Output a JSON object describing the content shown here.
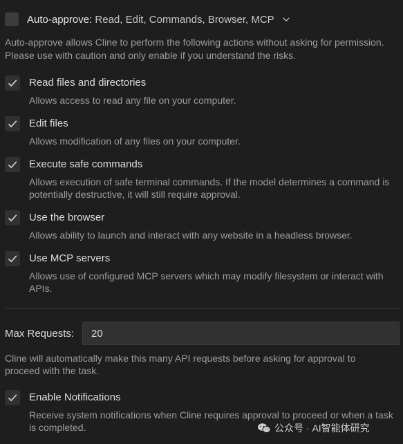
{
  "header": {
    "label": "Auto-approve:",
    "summary": "Read, Edit, Commands, Browser, MCP",
    "chevron_icon": "chevron-down-icon"
  },
  "description": "Auto-approve allows Cline to perform the following actions without asking for permission. Please use with caution and only enable if you understand the risks.",
  "actions": [
    {
      "label": "Read files and directories",
      "description": "Allows access to read any file on your computer.",
      "checked": true
    },
    {
      "label": "Edit files",
      "description": "Allows modification of any files on your computer.",
      "checked": true
    },
    {
      "label": "Execute safe commands",
      "description": "Allows execution of safe terminal commands. If the model determines a command is potentially destructive, it will still require approval.",
      "checked": true
    },
    {
      "label": "Use the browser",
      "description": "Allows ability to launch and interact with any website in a headless browser.",
      "checked": true
    },
    {
      "label": "Use MCP servers",
      "description": "Allows use of configured MCP servers which may modify filesystem or interact with APIs.",
      "checked": true
    }
  ],
  "max_requests": {
    "label": "Max Requests:",
    "value": "20",
    "description": "Cline will automatically make this many API requests before asking for approval to proceed with the task."
  },
  "notifications": {
    "label": "Enable Notifications",
    "description": "Receive system notifications when Cline requires approval to proceed or when a task is completed.",
    "checked": true
  },
  "watermark": {
    "text": "公众号 · AI智能体研究"
  },
  "colors": {
    "background": "#1e1e1e",
    "checkbox_bg": "#313131",
    "text": "#cccccc",
    "muted_text": "#9d9d9d"
  }
}
